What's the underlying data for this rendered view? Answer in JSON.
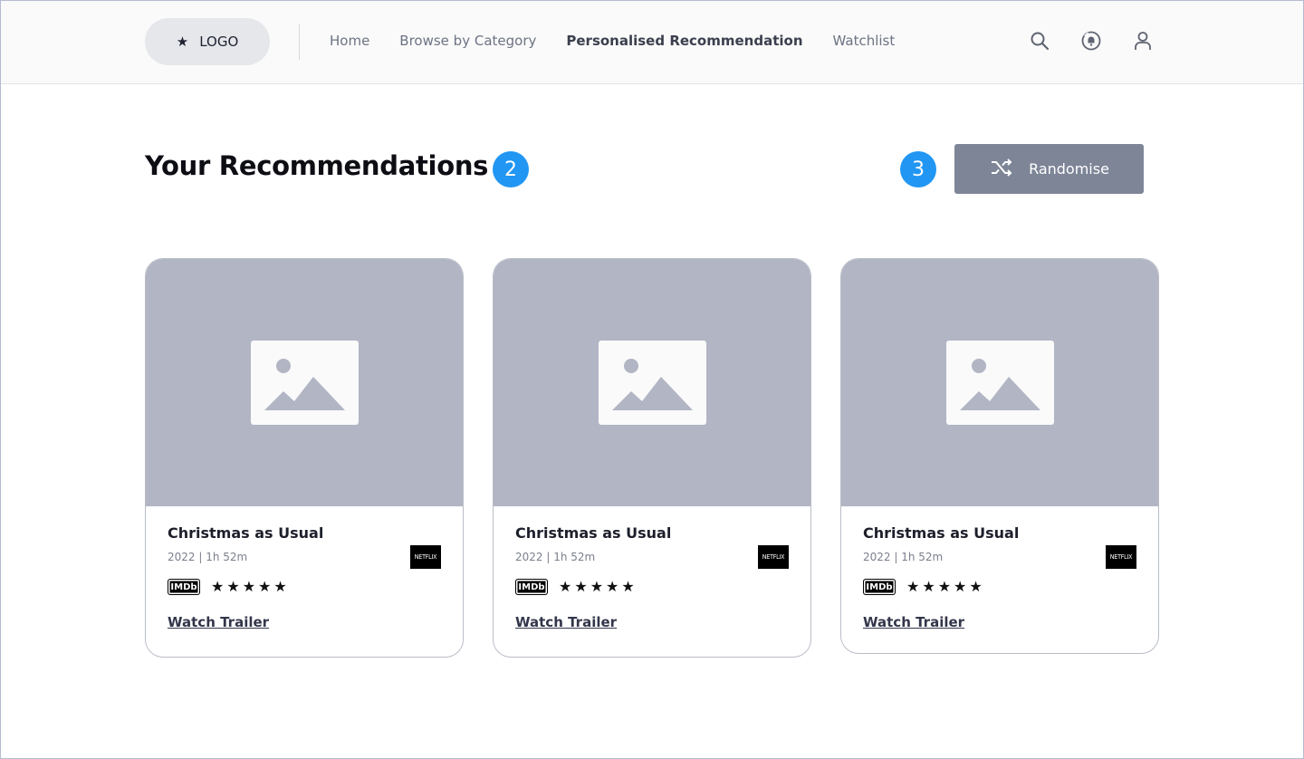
{
  "header": {
    "logo_label": "LOGO",
    "nav": [
      {
        "label": "Home",
        "active": false
      },
      {
        "label": "Browse by Category",
        "active": false
      },
      {
        "label": "Personalised Recommendation",
        "active": true
      },
      {
        "label": "Watchlist",
        "active": false
      }
    ],
    "icons": [
      "search-icon",
      "bell-icon",
      "user-icon"
    ]
  },
  "main": {
    "title": "Your Recommendations",
    "badge_title": "2",
    "badge_button": "3",
    "randomise_label": "Randomise"
  },
  "cards": [
    {
      "title": "Christmas as Usual",
      "meta": "2022 | 1h 52m",
      "provider": "NETFLIX",
      "rating_badge": "IMDb",
      "stars": "★★★★★",
      "rating_stars": 5,
      "link": "Watch Trailer"
    },
    {
      "title": "Christmas as Usual",
      "meta": "2022 | 1h 52m",
      "provider": "NETFLIX",
      "rating_badge": "IMDb",
      "stars": "★★★★★",
      "rating_stars": 5,
      "link": "Watch Trailer"
    },
    {
      "title": "Christmas as Usual",
      "meta": "2022 | 1h 52m",
      "provider": "NETFLIX",
      "rating_badge": "IMDb",
      "stars": "★★★★★",
      "rating_stars": 5,
      "link": "Watch Trailer"
    }
  ],
  "colors": {
    "accent_badge": "#2196f3",
    "button_bg": "#7d8597",
    "thumb_bg": "#b1b5c4"
  }
}
